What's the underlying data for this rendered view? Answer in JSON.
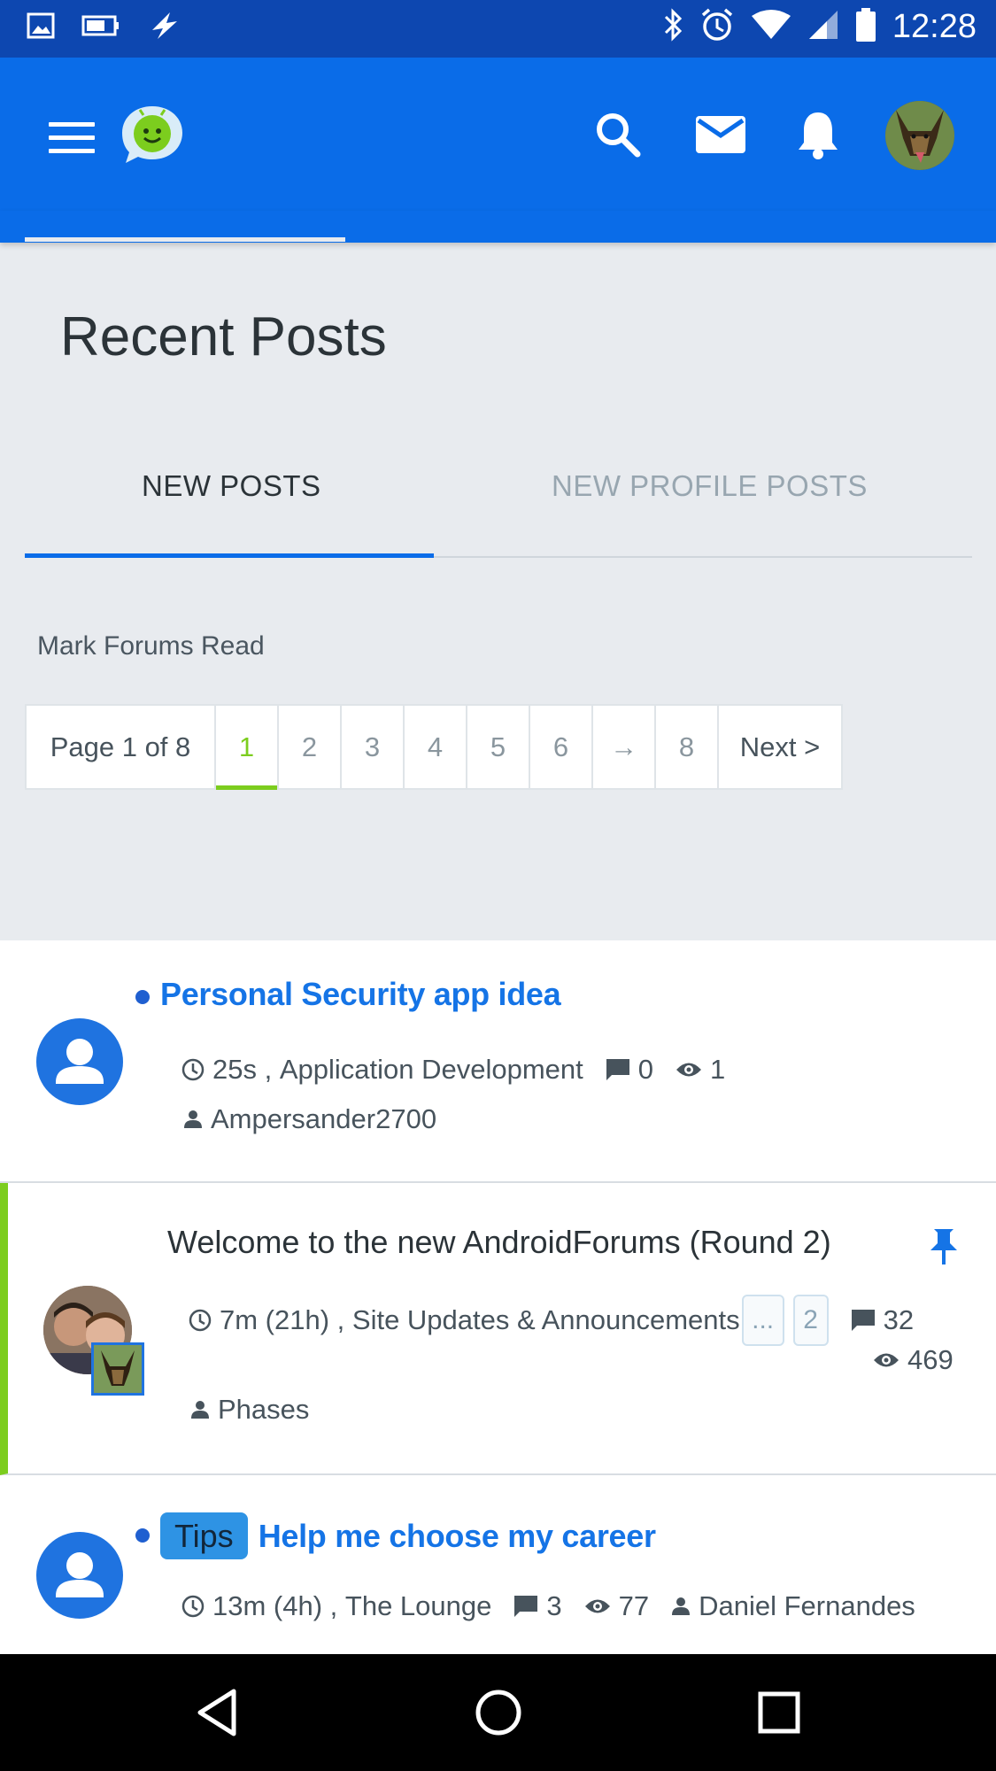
{
  "status_bar": {
    "time": "12:28",
    "left_icons": [
      "image-icon",
      "battery-saver-icon",
      "flash-icon"
    ],
    "right_icons": [
      "bluetooth-icon",
      "alarm-icon",
      "wifi-icon",
      "signal-icon",
      "battery-icon"
    ]
  },
  "app_bar": {
    "icons": [
      "menu-icon",
      "app-logo-icon",
      "search-icon",
      "mail-icon",
      "bell-icon",
      "user-avatar"
    ]
  },
  "page": {
    "title": "Recent Posts",
    "tabs": [
      {
        "label": "NEW POSTS",
        "active": true
      },
      {
        "label": "NEW PROFILE POSTS",
        "active": false
      }
    ],
    "mark_read": "Mark Forums Read"
  },
  "pagination": {
    "label": "Page 1 of 8",
    "pages": [
      "1",
      "2",
      "3",
      "4",
      "5",
      "6",
      "→",
      "8"
    ],
    "current": "1",
    "next": "Next >"
  },
  "posts": [
    {
      "title": "Personal Security app idea",
      "unread": true,
      "time": "25s",
      "forum": "Application Development",
      "replies": "0",
      "views": "1",
      "author": "Ampersander2700"
    },
    {
      "title": "Welcome to the new AndroidForums (Round 2)",
      "unread": false,
      "sticky": true,
      "time": "7m (21h)",
      "forum": "Site Updates & Announcements",
      "page_links": [
        "...",
        "2"
      ],
      "replies": "32",
      "views": "469",
      "author": "Phases"
    },
    {
      "tag": "Tips",
      "title": "Help me choose my career",
      "unread": true,
      "time": "13m (4h)",
      "forum": "The Lounge",
      "replies": "3",
      "views": "77",
      "author": "Daniel Fernandes"
    }
  ],
  "nav_bar": {
    "buttons": [
      "back-icon",
      "home-icon",
      "recents-icon"
    ]
  },
  "colors": {
    "status_bar": "#0d47b0",
    "app_bar": "#0a6ce8",
    "accent_green": "#7ccd1e",
    "link_blue": "#1574e6",
    "tag_blue": "#2e93e4"
  }
}
